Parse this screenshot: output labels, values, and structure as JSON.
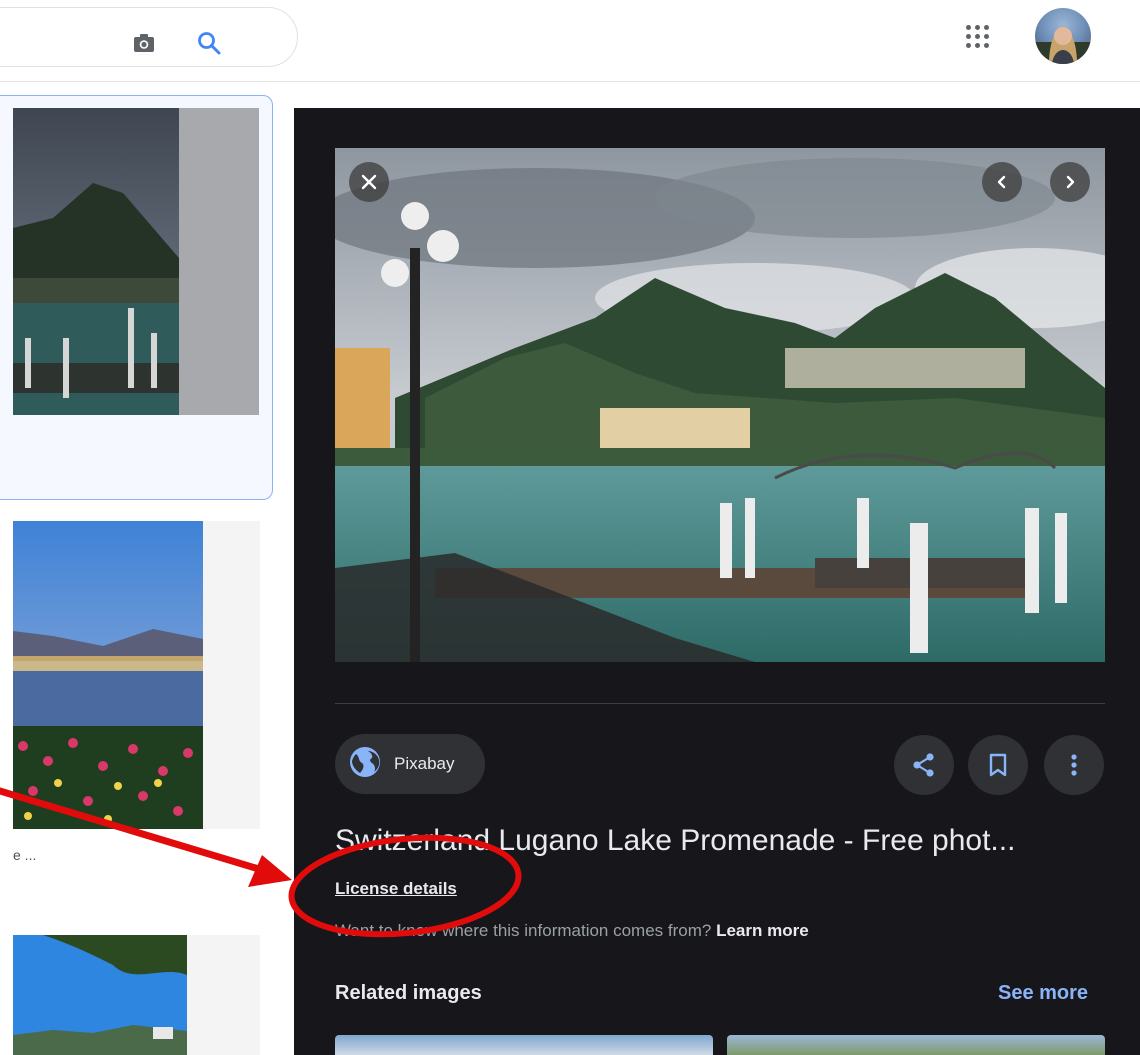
{
  "sidebar_caption": "e ...",
  "panel": {
    "source": "Pixabay",
    "title": "Switzerland Lugano Lake Promenade - Free phot...",
    "license": "License details",
    "info_prefix": "Want to know where this information comes from?",
    "info_link": "Learn more",
    "related_title": "Related images",
    "see_more": "See more"
  },
  "colors": {
    "panel_bg": "#17171b",
    "accent_link": "#8ab4f8",
    "annotation_red": "#e10b0b"
  },
  "icons": {
    "camera": "camera-icon",
    "search": "search-icon",
    "apps": "apps-grid-icon",
    "close": "close-icon",
    "prev": "chevron-left-icon",
    "next": "chevron-right-icon",
    "globe": "globe-icon",
    "share": "share-icon",
    "bookmark": "bookmark-icon",
    "more": "more-vert-icon"
  }
}
